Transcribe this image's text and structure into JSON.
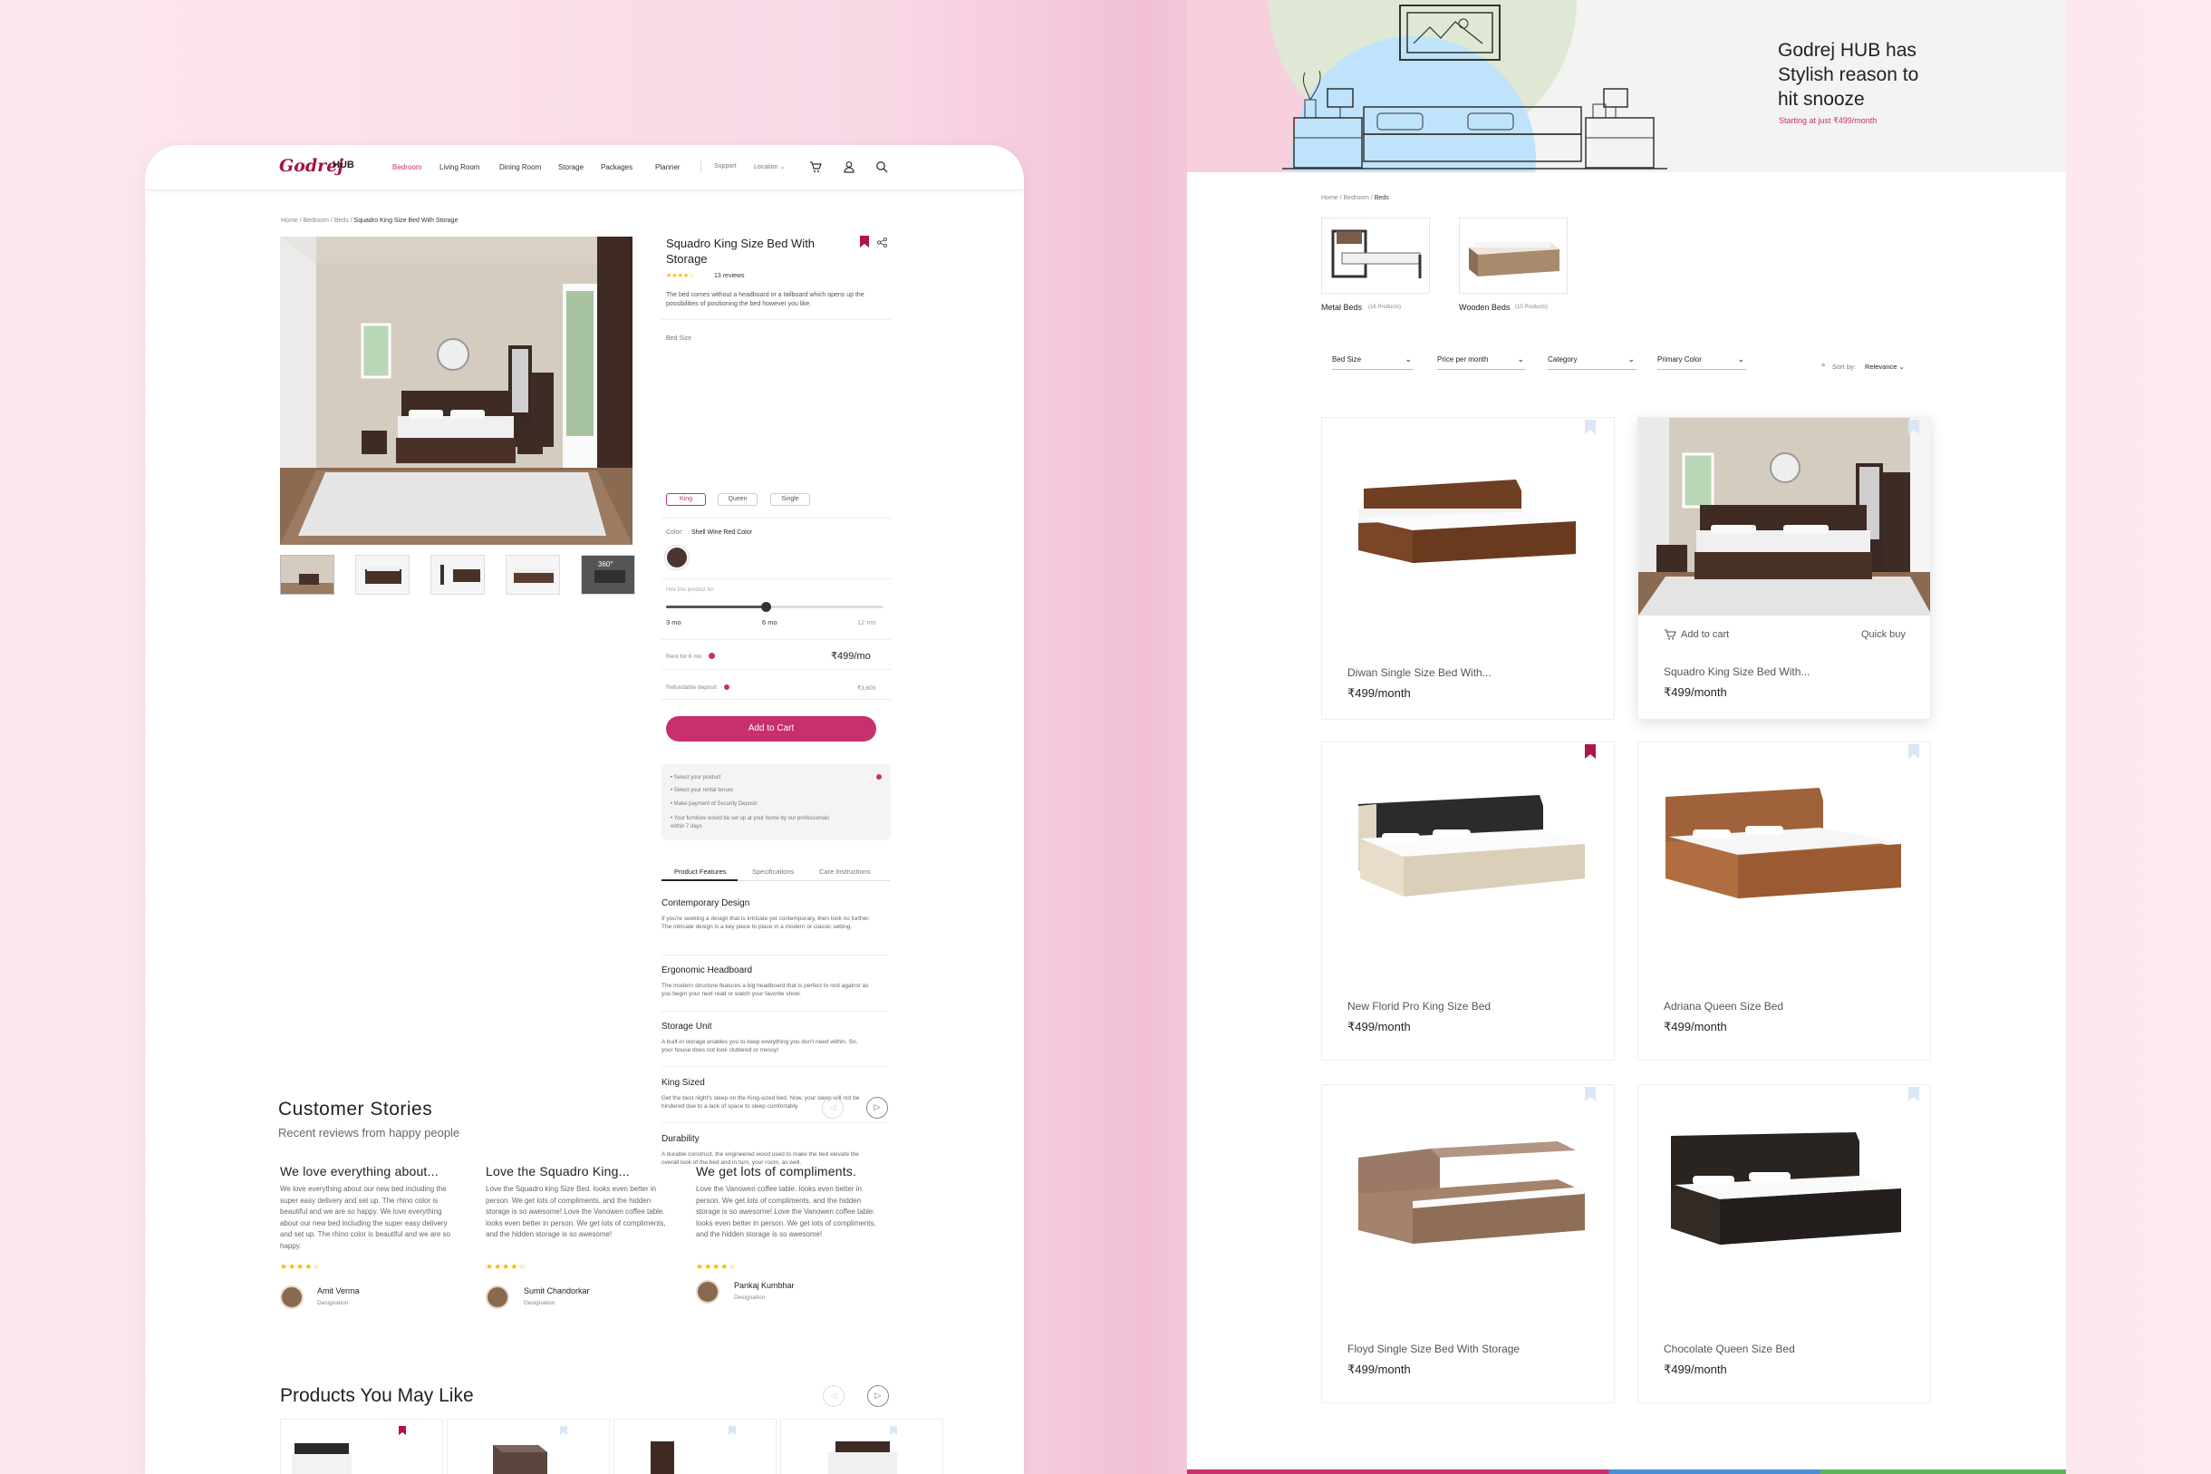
{
  "left_page": {
    "nav": {
      "logo": "Godrej",
      "logo_hub": "HUB",
      "items": [
        "Bedroom",
        "Living Room",
        "Dining Room",
        "Storage",
        "Packages",
        "Planner"
      ],
      "support": "Support",
      "location": "Location ⌄",
      "icons": [
        "cart-icon",
        "user-icon",
        "search-icon"
      ]
    },
    "breadcrumb": {
      "trail": "Home / Bedroom / Beds / ",
      "current": "Squadro King Size Bed With Storage"
    },
    "product": {
      "title": "Squadro King Size Bed With Storage",
      "rating": "★★★★☆",
      "reviews": "13 reviews",
      "description": "The bed comes without a headboard or a tailboard which opens up the possibilities of positioning the bed however you like.",
      "bed_size_label": "Bed Size",
      "sizes": [
        "King",
        "Queen",
        "Single"
      ],
      "selected_size": "King",
      "color_label": "Color:",
      "color_value": "Shell Wine Red Color",
      "swatch": "#4a3530",
      "hire_label": "Hire this product for",
      "tenure": [
        "3 mo",
        "6 mo",
        "12 mo"
      ],
      "tenure_value_months": 6,
      "rent_label": "Rent for 6 mo",
      "rent_value": "₹499/mo",
      "deposit_label": "Refundable deposit",
      "deposit_value": "₹3,600",
      "add_to_cart": "Add to Cart",
      "steps": [
        "Select your product",
        "Select your rental tenure",
        "Make payment of Security Deposit",
        "Your furniture would be set up at your home by our professionals within 7 days"
      ],
      "tabs": [
        "Product Features",
        "Specifications",
        "Care Instructions"
      ],
      "active_tab": "Product Features",
      "features": [
        {
          "title": "Contemporary Design",
          "desc": "If you're seeking a design that is intricate yet contemporary, then look no further. The intricate design is a key piece to place in a modern or classic setting."
        },
        {
          "title": "Ergonomic Headboard",
          "desc": "The modern structure features a big headboard that is perfect to rest against as you begin your next read or watch your favorite show."
        },
        {
          "title": "Storage Unit",
          "desc": "A built-in storage enables you to keep everything you don't need within. So, your house does not look cluttered or messy!"
        },
        {
          "title": "King Sized",
          "desc": "Get the best night's sleep on the King-sized bed. Now, your sleep will not be hindered due to a lack of space to sleep comfortably."
        },
        {
          "title": "Durability",
          "desc": "A durable construct, the engineered wood used to make the bed elevate the overall look of the bed and in turn, your room, as well."
        }
      ]
    },
    "stories": {
      "title": "Customer Stories",
      "subtitle": "Recent reviews from happy people",
      "items": [
        {
          "title": "We love everything about...",
          "text": "We love everything about our new bed including the super easy delivery and set up. The rhino color is beautiful and we are so happy. We love everything about our new bed including the super easy delivery and set up. The rhino color is beautiful and we are so happy.",
          "stars": "★★★★☆",
          "name": "Amit Verma",
          "role": "Designation"
        },
        {
          "title": "Love the Squadro King...",
          "text": "Love the Squadro king Size Bed. looks even better in person. We get lots of compliments, and the hidden storage is so awesome! Love the Vanowen coffee table. looks even better in person. We get lots of compliments, and the hidden storage is so awesome!",
          "stars": "★★★★☆",
          "name": "Sumit Chandorkar",
          "role": "Designation"
        },
        {
          "title": "We get lots of compliments.",
          "text": "Love the Vanowen coffee table. looks even better in person. We get lots of compliments, and the hidden storage is so awesome! Love the Vanowen coffee table. looks even better in person. We get lots of compliments, and the hidden storage is so awesome!",
          "stars": "★★★★☆",
          "name": "Pankaj Kumbhar",
          "role": "Designation"
        }
      ]
    },
    "may_like": {
      "title": "Products You May Like"
    }
  },
  "right_page": {
    "hero": {
      "headline": "Godrej HUB has Stylish reason to hit snooze",
      "subline": "Starting at just ₹499/month"
    },
    "breadcrumb": {
      "trail": "Home / Bedroom / ",
      "current": "Beds"
    },
    "categories": [
      {
        "name": "Metal Beds",
        "count": "(16 Products)"
      },
      {
        "name": "Wooden Beds",
        "count": "(10 Products)"
      }
    ],
    "filters": [
      "Bed Size",
      "Price per month",
      "Category",
      "Primary Color"
    ],
    "sort": {
      "label": "Sort by:",
      "value": "Relevance ⌄"
    },
    "products": [
      {
        "name": "Diwan Single Size Bed With...",
        "price": "₹499/month",
        "bookmarked": false
      },
      {
        "name": "Squadro King Size Bed With...",
        "price": "₹499/month",
        "bookmarked": false,
        "add_to_cart": "Add to cart",
        "quick_buy": "Quick buy"
      },
      {
        "name": "New Florid Pro King Size Bed",
        "price": "₹499/month",
        "bookmarked": true
      },
      {
        "name": "Adriana Queen Size Bed",
        "price": "₹499/month",
        "bookmarked": false
      },
      {
        "name": "Floyd Single Size Bed With Storage",
        "price": "₹499/month",
        "bookmarked": false
      },
      {
        "name": "Chocolate Queen Size Bed",
        "price": "₹499/month",
        "bookmarked": false
      }
    ]
  },
  "colors": {
    "accent": "#c7306c",
    "bookmark_active": "#b0144f",
    "bookmark_inactive": "#dbe7f7"
  }
}
